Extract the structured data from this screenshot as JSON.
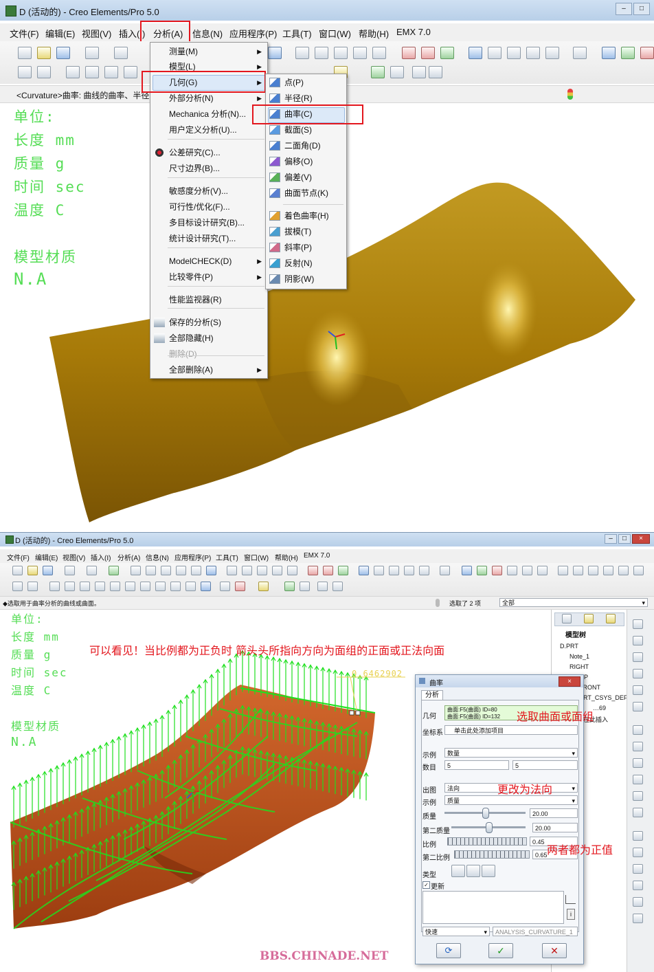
{
  "colors": {
    "menu_highlight_box": "#e3161d",
    "info_text": "#55dd55",
    "annotation": "#e3161d",
    "surface_top": "#b68a12",
    "surface_bottom": "#c8581e",
    "vectors": "#1ee01e"
  },
  "top": {
    "title": "D (活动的) - Creo Elements/Pro 5.0",
    "menu": [
      "文件(F)",
      "编辑(E)",
      "视图(V)",
      "插入(I)",
      "分析(A)",
      "信息(N)",
      "应用程序(P)",
      "工具(T)",
      "窗口(W)",
      "帮助(H)",
      "EMX 7.0"
    ],
    "status_text": "<Curvature>曲率: 曲线的曲率、半径",
    "info": [
      "单位:",
      "长度 mm",
      "质量 g",
      "时间 sec",
      "温度 C",
      "",
      "模型材质",
      "N.A"
    ],
    "analysis_menu": {
      "items": [
        {
          "label": "测量(M)",
          "arrow": true
        },
        {
          "label": "模型(L)",
          "arrow": true
        },
        {
          "label": "几何(G)",
          "arrow": true
        },
        {
          "label": "外部分析(N)",
          "arrow": true
        },
        {
          "label": "Mechanica 分析(N)...",
          "arrow": false
        },
        {
          "label": "用户定义分析(U)...",
          "arrow": false
        },
        {
          "label": "公差研究(C)...",
          "arrow": false
        },
        {
          "label": "尺寸边界(B)...",
          "arrow": false
        },
        {
          "label": "敏感度分析(V)...",
          "arrow": false
        },
        {
          "label": "可行性/优化(F)...",
          "arrow": false
        },
        {
          "label": "多目标设计研究(B)...",
          "arrow": false
        },
        {
          "label": "统计设计研究(T)...",
          "arrow": false
        },
        {
          "label": "ModelCHECK(D)",
          "arrow": true
        },
        {
          "label": "比较零件(P)",
          "arrow": true
        },
        {
          "label": "性能监视器(R)",
          "arrow": false
        },
        {
          "label": "保存的分析(S)",
          "arrow": false
        },
        {
          "label": "全部隐藏(H)",
          "arrow": false
        },
        {
          "label": "删除(D)",
          "arrow": false,
          "disabled": true
        },
        {
          "label": "全部删除(A)",
          "arrow": true
        }
      ]
    },
    "geometry_submenu": [
      "点(P)",
      "半径(R)",
      "曲率(C)",
      "截面(S)",
      "二面角(D)",
      "偏移(O)",
      "偏差(V)",
      "曲面节点(K)",
      "着色曲率(H)",
      "拔模(T)",
      "斜率(P)",
      "反射(N)",
      "阴影(W)"
    ]
  },
  "bottom": {
    "title": "D (活动的) - Creo Elements/Pro 5.0",
    "menu": [
      "文件(F)",
      "编辑(E)",
      "视图(V)",
      "插入(I)",
      "分析(A)",
      "信息(N)",
      "应用程序(P)",
      "工具(T)",
      "窗口(W)",
      "帮助(H)",
      "EMX 7.0"
    ],
    "status_text": "◆选取用于曲率分析的曲线或曲面。",
    "selected_text": "选取了 2 项",
    "filter_value": "全部",
    "info": [
      "单位:",
      "长度 mm",
      "质量 g",
      "时间 sec",
      "温度 C",
      "",
      "模型材质",
      "N.A"
    ],
    "annotation_main": "可以看见！当比例都为正负时 箭头头所指向方向为面组的正面或正法向面",
    "dimension_value": "0.6462902",
    "watermark": "BBS.CHINADE.NET",
    "tree": {
      "tab": "模型树",
      "items": [
        "D.PRT",
        "Note_1",
        "RIGHT",
        "OP",
        "FRONT",
        "PRT_CSYS_DEF",
        "…69",
        "在此插入"
      ]
    },
    "dialog": {
      "title": "曲率",
      "tab": "分析",
      "geometry_label": "几何",
      "geometry_lines": [
        "曲面:F5(曲面)  ID=80",
        "曲面:F5(曲面)  ID=132"
      ],
      "csys_label": "坐标系",
      "csys_value": "单击此处添加项目",
      "sample_label": "示例",
      "sample_value": "数量",
      "number_label": "数目",
      "number_a": "5",
      "number_b": "5",
      "plot_label": "出图",
      "plot_value": "法向",
      "sample2_label": "示例",
      "sample2_value": "质量",
      "quality_label": "质量",
      "quality_value": "20.00",
      "quality_pos": 0.5,
      "quality2_label": "第二质量",
      "quality2_value": "20.00",
      "quality2_pos": 0.5,
      "scale_label": "比例",
      "scale_value": "0.45",
      "scale2_label": "第二比例",
      "scale2_value": "0.65",
      "type_label": "类型",
      "update_label": "更新",
      "mode_value": "快速",
      "name_value": "ANALYSIS_CURVATURE_1"
    },
    "annot_select": "选取曲面或面组",
    "annot_normal": "更改为法向",
    "annot_positive": "两者都为正值"
  }
}
